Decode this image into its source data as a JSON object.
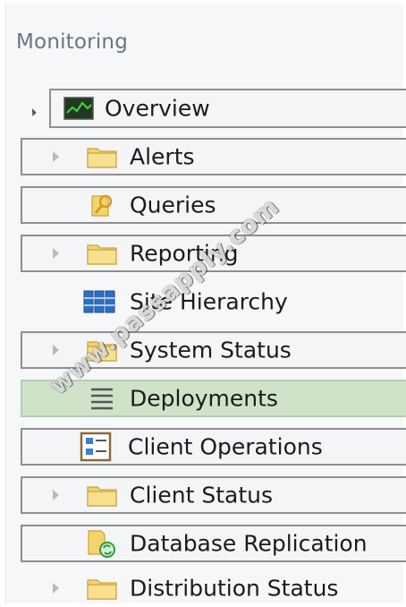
{
  "section_title": "Monitoring",
  "tree": {
    "overview": {
      "label": "Overview",
      "icon": "monitor-chart-icon",
      "expanded": true
    },
    "items": [
      {
        "label": "Alerts",
        "icon": "folder-icon",
        "expandable": true
      },
      {
        "label": "Queries",
        "icon": "queries-icon",
        "expandable": false
      },
      {
        "label": "Reporting",
        "icon": "folder-icon",
        "expandable": true
      },
      {
        "label": "Site Hierarchy",
        "icon": "site-hierarchy-icon",
        "expandable": false
      },
      {
        "label": "System Status",
        "icon": "folder-icon",
        "expandable": true
      },
      {
        "label": "Deployments",
        "icon": "deployments-icon",
        "expandable": false,
        "selected": true
      },
      {
        "label": "Client Operations",
        "icon": "client-operations-icon",
        "expandable": false
      },
      {
        "label": "Client Status",
        "icon": "folder-icon",
        "expandable": true
      },
      {
        "label": "Database Replication",
        "icon": "database-replication-icon",
        "expandable": false
      },
      {
        "label": "Distribution Status",
        "icon": "folder-icon",
        "expandable": true
      }
    ]
  },
  "watermark": "www.passapply.com",
  "colors": {
    "selected_bg": "#cfe3c9",
    "row_border": "#8f8f8f",
    "folder": "#f3d46c",
    "title": "#6b7580"
  }
}
